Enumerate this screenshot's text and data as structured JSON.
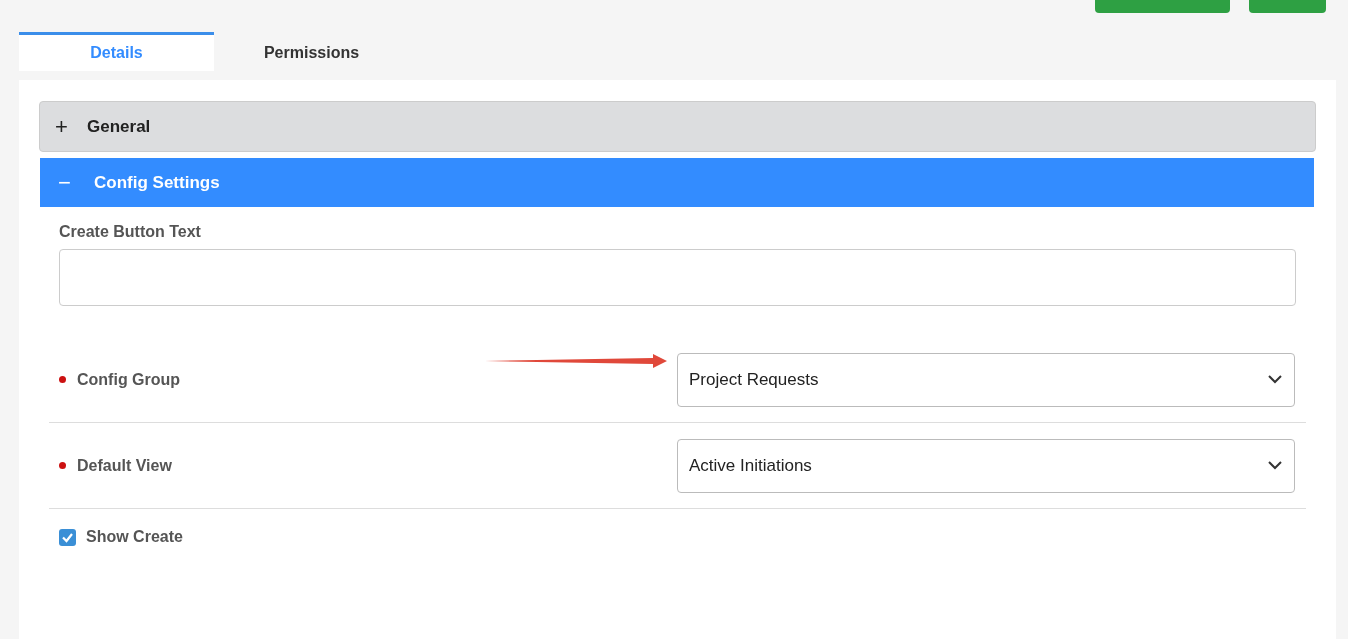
{
  "header_buttons": [
    {
      "kind": "primary"
    },
    {
      "kind": "primary"
    }
  ],
  "tabs": [
    {
      "label": "Details",
      "selected": true
    },
    {
      "label": "Permissions",
      "selected": false
    }
  ],
  "sections": [
    {
      "label": "General",
      "icon": "+",
      "expanded": false
    },
    {
      "label": "Config Settings",
      "icon": "−",
      "expanded": true
    }
  ],
  "fields": [
    {
      "kind": "text",
      "label": "Create Button Text"
    },
    {
      "kind": "select",
      "label": "Config Group",
      "value": "Project Requests",
      "required": true,
      "annotated": true
    },
    {
      "kind": "select",
      "label": "Default View",
      "value": "Active Initiations",
      "required": true
    },
    {
      "kind": "checkbox",
      "label": "Show Create",
      "checked": true
    }
  ]
}
